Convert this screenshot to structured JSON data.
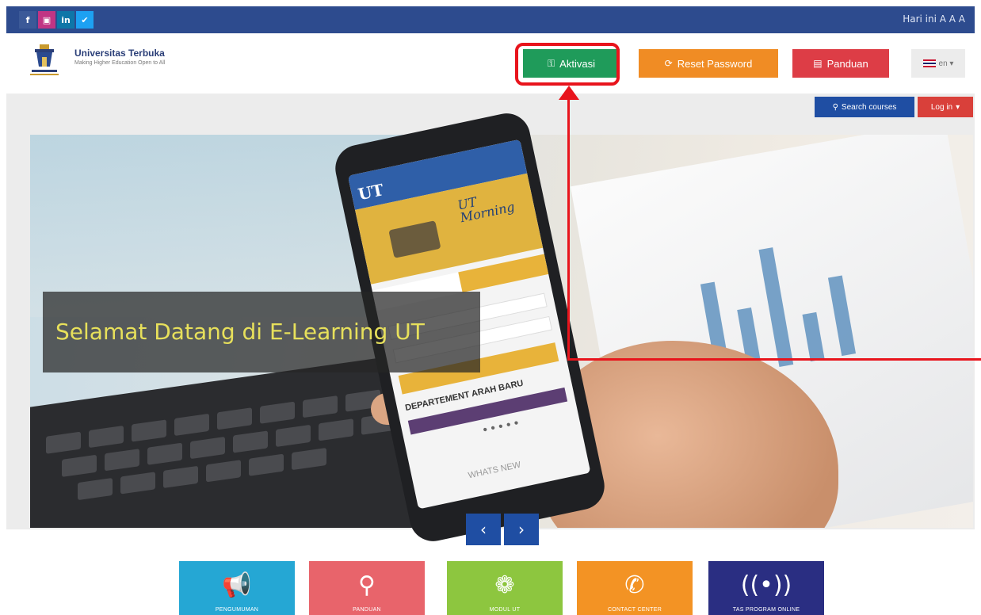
{
  "topbar": {
    "social": [
      {
        "name": "facebook",
        "glyph": "f",
        "color": "#3b5998"
      },
      {
        "name": "instagram",
        "glyph": "▣",
        "color": "#c13584"
      },
      {
        "name": "linkedin",
        "glyph": "in",
        "color": "#0e76a8"
      },
      {
        "name": "twitter",
        "glyph": "✔",
        "color": "#1da1f2"
      }
    ],
    "right_text": "Hari ini  A A A"
  },
  "header": {
    "logo_title": "Universitas Terbuka",
    "logo_sub": "Making Higher Education Open to All",
    "buttons": {
      "aktivasi": "Aktivasi",
      "reset": "Reset Password",
      "panduan": "Panduan"
    },
    "lang": "en ▾"
  },
  "subbar": {
    "search": "Search courses",
    "login": "Log in"
  },
  "hero": {
    "welcome": "Selamat Datang di E-Learning UT",
    "phone": {
      "ut": "UT",
      "morning": "UT Morning",
      "heading": "DEPARTEMENT ARAH BARU",
      "whats": "WHATS NEW"
    }
  },
  "carousel": {
    "prev": "‹",
    "next": "›"
  },
  "tiles": [
    {
      "name": "pengumuman",
      "label": "PENGUMUMAN",
      "icon": "📢",
      "color": "#25a7d4"
    },
    {
      "name": "panduan",
      "label": "PANDUAN",
      "icon": "⚲",
      "color": "#e8646b"
    },
    {
      "name": "modul",
      "label": "MODUL UT",
      "icon": "❁",
      "color": "#8dc63f"
    },
    {
      "name": "contact",
      "label": "CONTACT CENTER",
      "icon": "✆",
      "color": "#f39324"
    },
    {
      "name": "tutorial",
      "label": "TAS PROGRAM ONLINE",
      "icon": "((•))",
      "color": "#2a2e82"
    }
  ],
  "colors": {
    "topbar": "#2d4b8e",
    "aktivasi": "#1f9b5a",
    "reset": "#f08c24",
    "panduan": "#dd3d46",
    "search": "#1f4ea3",
    "login": "#d9403a",
    "annotation": "#e8141c"
  }
}
